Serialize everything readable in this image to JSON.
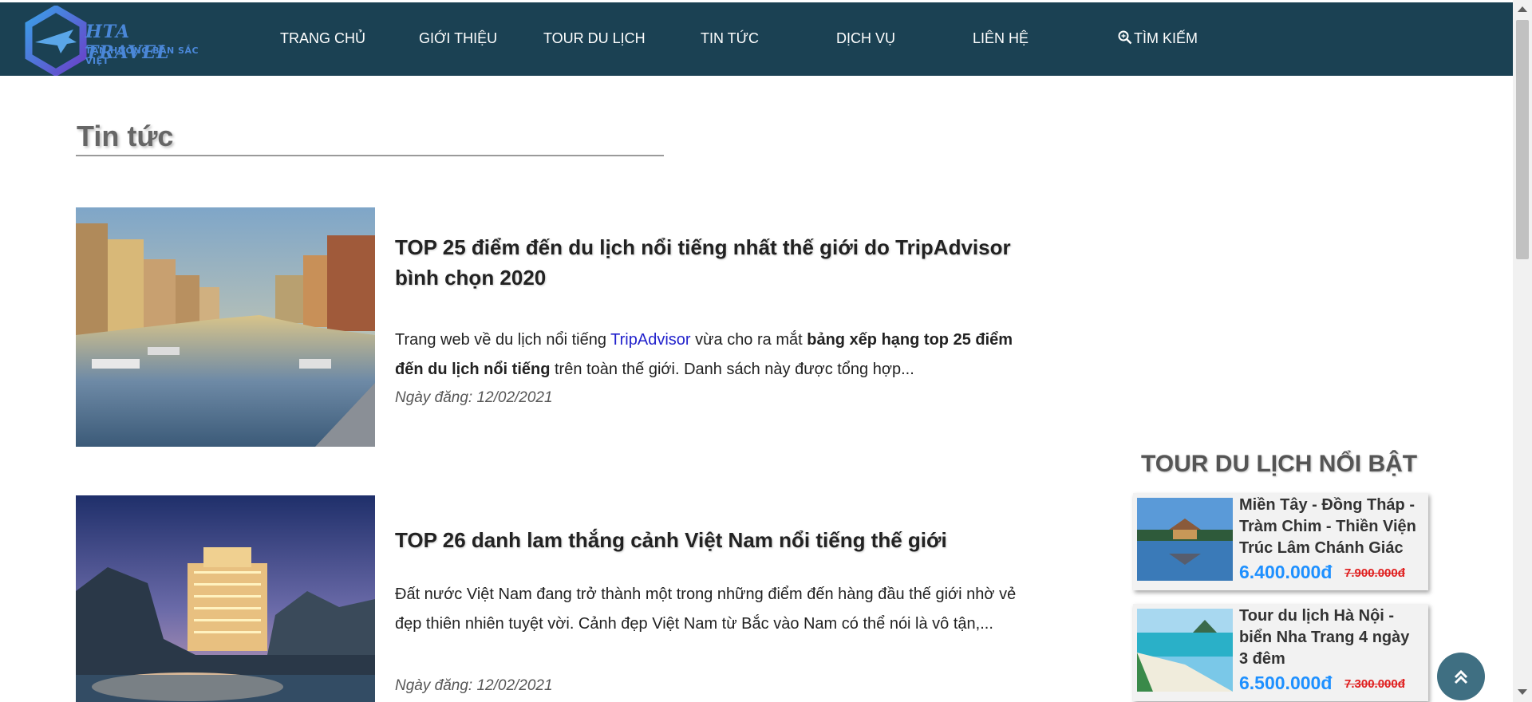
{
  "header": {
    "logo_title": "HTA TRAVEL",
    "logo_subtitle": "TẬN HƯỞNG BẢN SẮC VIỆT",
    "nav": [
      "TRANG CHỦ",
      "GIỚI THIỆU",
      "TOUR DU LỊCH",
      "TIN TỨC",
      "DỊCH VỤ",
      "LIÊN HỆ"
    ],
    "search_label": "TÌM KIẾM"
  },
  "main": {
    "section_title": "Tin tức",
    "articles": [
      {
        "title": "TOP 25 điểm đến du lịch nổi tiếng nhất thế giới do TripAdvisor bình chọn 2020",
        "desc_part1": "Trang web về du lịch nổi tiếng ",
        "desc_link": "TripAdvisor",
        "desc_part2": " vừa cho ra mắt ",
        "desc_bold": "bảng xếp hạng top 25 điểm đến du lịch nổi tiếng",
        "desc_part3": " trên toàn thế giới. Danh sách này được tổng hợp...",
        "date": "Ngày đăng: 12/02/2021"
      },
      {
        "title": "TOP 26 danh lam thắng cảnh Việt Nam nổi tiếng thế giới",
        "desc": "Đất nước Việt Nam đang trở thành một trong những điểm đến hàng đầu thế giới nhờ vẻ đẹp thiên nhiên tuyệt vời. Cảnh đẹp Việt Nam từ Bắc vào Nam có thể nói là vô tận,...",
        "date": "Ngày đăng: 12/02/2021"
      }
    ]
  },
  "sidebar": {
    "title": "TOUR DU LỊCH NỔI BẬT",
    "tours": [
      {
        "name": "Miền Tây - Đồng Tháp - Tràm Chim - Thiền Viện Trúc Lâm Chánh Giác",
        "price": "6.400.000đ",
        "old_price": "7.900.000đ"
      },
      {
        "name": "Tour du lịch Hà Nội - biển Nha Trang 4 ngày 3 đêm",
        "price": "6.500.000đ",
        "old_price": "7.300.000đ"
      }
    ]
  },
  "colors": {
    "header_bg": "#1b4153",
    "price": "#1e90ff",
    "old_price": "#e02020",
    "link": "#2222cc"
  },
  "icons": [
    "logo-plane-hexagon",
    "search-icon",
    "chevrons-up-icon"
  ]
}
